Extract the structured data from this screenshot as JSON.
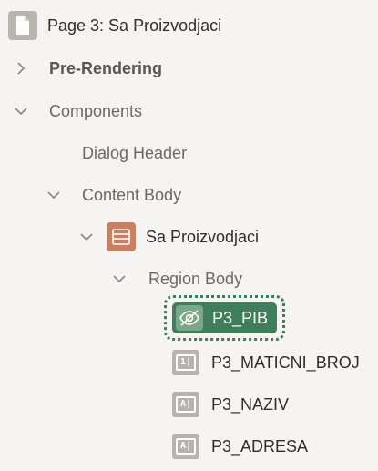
{
  "tree": {
    "page": {
      "label": "Page 3: Sa Proizvodjaci",
      "icon": "page-icon"
    },
    "pre_rendering": {
      "label": "Pre-Rendering",
      "icon": "chevron-right-icon"
    },
    "components": {
      "label": "Components",
      "icon": "chevron-down-icon"
    },
    "dialog_header": {
      "label": "Dialog Header"
    },
    "content_body": {
      "label": "Content Body",
      "icon": "chevron-down-icon"
    },
    "region": {
      "label": "Sa Proizvodjaci",
      "icon": "region-icon"
    },
    "region_body": {
      "label": "Region Body",
      "icon": "chevron-down-icon"
    },
    "items": [
      {
        "label": "P3_PIB",
        "icon": "hidden-item-icon",
        "selected": true
      },
      {
        "label": "P3_MATICNI_BROJ",
        "icon": "number-field-icon",
        "glyph": "1|"
      },
      {
        "label": "P3_NAZIV",
        "icon": "text-field-icon",
        "glyph": "A|"
      },
      {
        "label": "P3_ADRESA",
        "icon": "text-field-icon",
        "glyph": "A|"
      }
    ]
  },
  "colors": {
    "selected_bg": "#3f7e5a",
    "region_icon": "#c97f62",
    "page_icon": "#b9b4ae"
  }
}
